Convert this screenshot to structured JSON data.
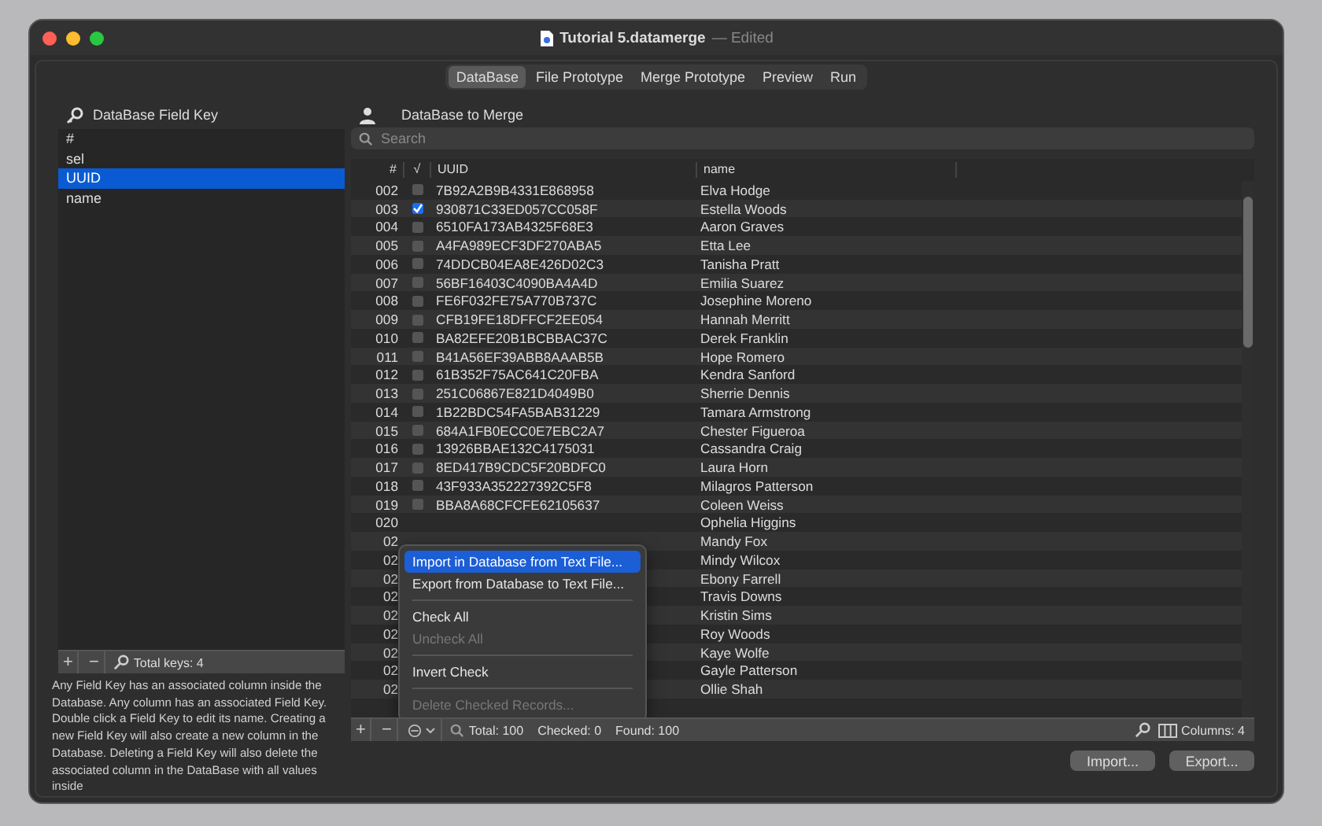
{
  "window": {
    "title": "Tutorial 5.datamerge",
    "status": "— Edited"
  },
  "tabs": [
    {
      "label": "DataBase",
      "selected": true
    },
    {
      "label": "File Prototype",
      "selected": false
    },
    {
      "label": "Merge Prototype",
      "selected": false
    },
    {
      "label": "Preview",
      "selected": false
    },
    {
      "label": "Run",
      "selected": false
    }
  ],
  "field_keys": {
    "title": "DataBase Field Key",
    "items": [
      {
        "label": "#",
        "selected": false
      },
      {
        "label": "sel",
        "selected": false
      },
      {
        "label": "UUID",
        "selected": true
      },
      {
        "label": "name",
        "selected": false
      }
    ],
    "add": "+",
    "remove": "−",
    "total": "Total keys: 4",
    "help": "Any Field Key has an associated column inside the Database. Any column has an associated Field Key. Double click a Field Key to edit its name. Creating a new Field Key will also create a new column in the Database. Deleting a Field Key will also delete the associated column in the DataBase with all values inside"
  },
  "database": {
    "title": "DataBase to Merge",
    "search": {
      "placeholder": "Search"
    },
    "columns": [
      "#",
      "√",
      "UUID",
      "name"
    ],
    "rows": [
      {
        "num": "002",
        "checked": false,
        "uuid": "7B92A2B9B4331E868958",
        "name": "Elva Hodge"
      },
      {
        "num": "003",
        "checked": true,
        "uuid": "930871C33ED057CC058F",
        "name": "Estella Woods"
      },
      {
        "num": "004",
        "checked": false,
        "uuid": "6510FA173AB4325F68E3",
        "name": "Aaron Graves"
      },
      {
        "num": "005",
        "checked": false,
        "uuid": "A4FA989ECF3DF270ABA5",
        "name": "Etta Lee"
      },
      {
        "num": "006",
        "checked": false,
        "uuid": "74DDCB04EA8E426D02C3",
        "name": "Tanisha Pratt"
      },
      {
        "num": "007",
        "checked": false,
        "uuid": "56BF16403C4090BA4A4D",
        "name": "Emilia Suarez"
      },
      {
        "num": "008",
        "checked": false,
        "uuid": "FE6F032FE75A770B737C",
        "name": "Josephine Moreno"
      },
      {
        "num": "009",
        "checked": false,
        "uuid": "CFB19FE18DFFCF2EE054",
        "name": "Hannah Merritt"
      },
      {
        "num": "010",
        "checked": false,
        "uuid": "BA82EFE20B1BCBBAC37C",
        "name": "Derek Franklin"
      },
      {
        "num": "011",
        "checked": false,
        "uuid": "B41A56EF39ABB8AAAB5B",
        "name": "Hope Romero"
      },
      {
        "num": "012",
        "checked": false,
        "uuid": "61B352F75AC641C20FBA",
        "name": "Kendra Sanford"
      },
      {
        "num": "013",
        "checked": false,
        "uuid": "251C06867E821D4049B0",
        "name": "Sherrie Dennis"
      },
      {
        "num": "014",
        "checked": false,
        "uuid": "1B22BDC54FA5BAB31229",
        "name": "Tamara Armstrong"
      },
      {
        "num": "015",
        "checked": false,
        "uuid": "684A1FB0ECC0E7EBC2A7",
        "name": "Chester Figueroa"
      },
      {
        "num": "016",
        "checked": false,
        "uuid": "13926BBAE132C4175031",
        "name": "Cassandra Craig"
      },
      {
        "num": "017",
        "checked": false,
        "uuid": "8ED417B9CDC5F20BDFC0",
        "name": "Laura Horn"
      },
      {
        "num": "018",
        "checked": false,
        "uuid": "43F933A352227392C5F8",
        "name": "Milagros Patterson"
      },
      {
        "num": "019",
        "checked": false,
        "uuid": "BBA8A68CFCFE62105637",
        "name": "Coleen Weiss"
      },
      {
        "num": "020",
        "name": "Ophelia Higgins"
      },
      {
        "num": "02",
        "name": "Mandy Fox"
      },
      {
        "num": "02",
        "name": "Mindy Wilcox"
      },
      {
        "num": "02",
        "name": "Ebony Farrell"
      },
      {
        "num": "02",
        "name": "Travis Downs"
      },
      {
        "num": "02",
        "name": "Kristin Sims"
      },
      {
        "num": "02",
        "name": "Roy Woods"
      },
      {
        "num": "02",
        "name": "Kaye Wolfe"
      },
      {
        "num": "02",
        "name": "Gayle Patterson"
      },
      {
        "num": "02",
        "name": "Ollie Shah"
      }
    ],
    "add": "+",
    "remove": "−",
    "total": "Total: 100",
    "checked": "Checked: 0",
    "found": "Found: 100",
    "columns_count": "Columns: 4"
  },
  "context_menu": [
    {
      "kind": "item",
      "label": "Import in Database from Text File...",
      "selected": true,
      "disabled": false
    },
    {
      "kind": "item",
      "label": "Export from Database to Text File...",
      "selected": false,
      "disabled": false
    },
    {
      "kind": "separator"
    },
    {
      "kind": "item",
      "label": "Check All",
      "selected": false,
      "disabled": false
    },
    {
      "kind": "item",
      "label": "Uncheck All",
      "selected": false,
      "disabled": true
    },
    {
      "kind": "separator"
    },
    {
      "kind": "item",
      "label": "Invert Check",
      "selected": false,
      "disabled": false
    },
    {
      "kind": "separator"
    },
    {
      "kind": "item",
      "label": "Delete Checked Records...",
      "selected": false,
      "disabled": true
    }
  ],
  "buttons": [
    "Import...",
    "Export..."
  ]
}
